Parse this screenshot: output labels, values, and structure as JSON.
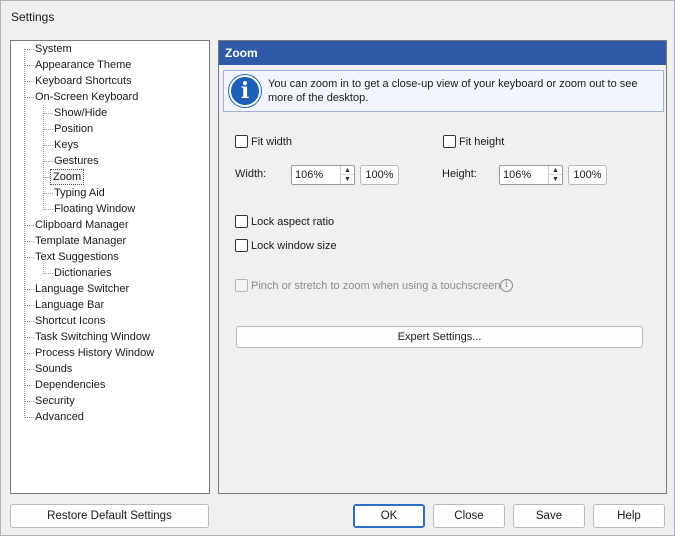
{
  "window": {
    "title": "Settings"
  },
  "tree": {
    "items": [
      {
        "label": "System"
      },
      {
        "label": "Appearance Theme"
      },
      {
        "label": "Keyboard Shortcuts"
      },
      {
        "label": "On-Screen Keyboard"
      },
      {
        "label": "Show/Hide"
      },
      {
        "label": "Position"
      },
      {
        "label": "Keys"
      },
      {
        "label": "Gestures"
      },
      {
        "label": "Zoom",
        "selected": true
      },
      {
        "label": "Typing Aid"
      },
      {
        "label": "Floating Window"
      },
      {
        "label": "Clipboard Manager"
      },
      {
        "label": "Template Manager"
      },
      {
        "label": "Text Suggestions"
      },
      {
        "label": "Dictionaries"
      },
      {
        "label": "Language Switcher"
      },
      {
        "label": "Language Bar"
      },
      {
        "label": "Shortcut Icons"
      },
      {
        "label": "Task Switching Window"
      },
      {
        "label": "Process History Window"
      },
      {
        "label": "Sounds"
      },
      {
        "label": "Dependencies"
      },
      {
        "label": "Security"
      },
      {
        "label": "Advanced"
      }
    ]
  },
  "panel": {
    "title": "Zoom",
    "info": "You can zoom in to get a close-up view of your keyboard or zoom out to see more of the desktop.",
    "fit_width": {
      "label": "Fit width",
      "checked": false
    },
    "fit_height": {
      "label": "Fit height",
      "checked": false
    },
    "width": {
      "label": "Width:",
      "value": "106%",
      "reset_label": "100%"
    },
    "height": {
      "label": "Height:",
      "value": "106%",
      "reset_label": "100%"
    },
    "lock_aspect": {
      "label": "Lock aspect ratio",
      "checked": false
    },
    "lock_size": {
      "label": "Lock window size",
      "checked": false
    },
    "pinch": {
      "label": "Pinch or stretch to zoom when using a touchscreen",
      "checked": false,
      "enabled": false
    },
    "expert_button": "Expert Settings..."
  },
  "footer": {
    "restore": "Restore Default Settings",
    "ok": "OK",
    "close": "Close",
    "save": "Save",
    "help": "Help"
  },
  "icons": {
    "info": "info-icon",
    "hint": "help-circle-icon",
    "spin_up": "chevron-up-icon",
    "spin_down": "chevron-down-icon"
  },
  "colors": {
    "header": "#2e5aa8",
    "info_icon": "#1b5fb7",
    "primary_border": "#2b6fc6"
  }
}
